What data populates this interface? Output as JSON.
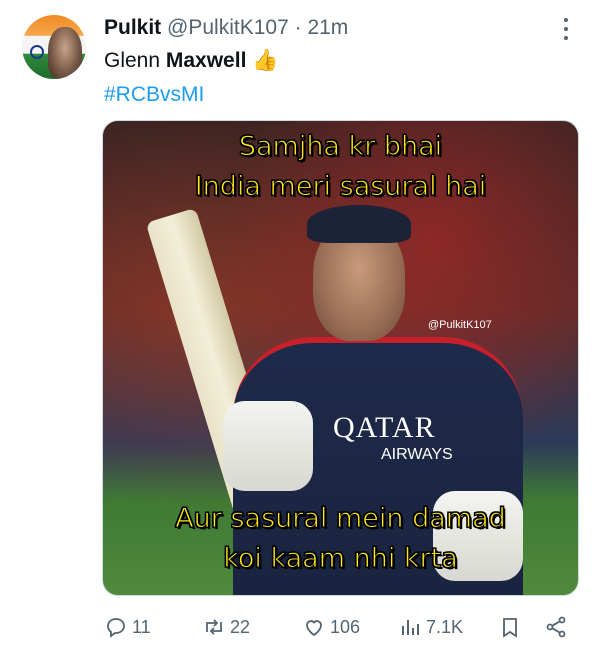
{
  "tweet": {
    "author_name": "Pulkit",
    "handle": "@PulkitK107",
    "separator": "·",
    "time": "21m",
    "text_plain": "Glenn ",
    "text_bold": "Maxwell",
    "emoji": "👍",
    "hashtag": "#RCBvsMI"
  },
  "media": {
    "caption_top_line1": "Samjha kr bhai",
    "caption_top_line2": "India meri sasural hai",
    "caption_bottom_line1": "Aur sasural mein damad",
    "caption_bottom_line2": "koi kaam nhi krta",
    "watermark": "@PulkitK107",
    "jersey_brand": "QATAR",
    "jersey_sub": "AIRWAYS"
  },
  "actions": {
    "reply_count": "11",
    "retweet_count": "22",
    "like_count": "106",
    "views_count": "7.1K"
  },
  "icons": {
    "reply": "reply-icon",
    "retweet": "retweet-icon",
    "like": "heart-icon",
    "views": "views-icon",
    "bookmark": "bookmark-icon",
    "share": "share-icon",
    "more": "more-icon"
  },
  "colors": {
    "hashtag": "#1d9bf0",
    "muted": "#536471",
    "caption": "#ffe81a"
  }
}
